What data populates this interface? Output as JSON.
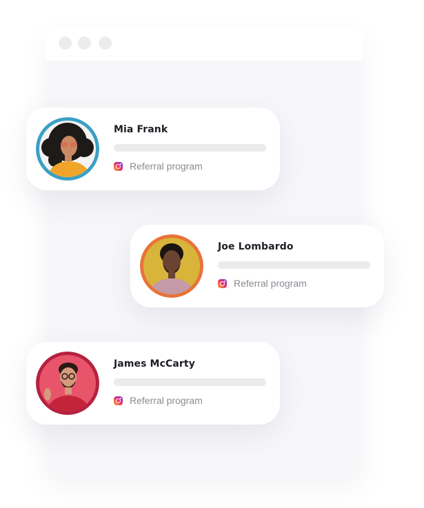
{
  "window": {
    "dots": [
      "window-dot",
      "window-dot",
      "window-dot"
    ]
  },
  "cards": [
    {
      "name": "Mia Frank",
      "source": "Referral program",
      "source_icon": "instagram-icon",
      "ring_color": "#3aa0c4"
    },
    {
      "name": "Joe Lombardo",
      "source": "Referral program",
      "source_icon": "instagram-icon",
      "ring_color": "#e8733a"
    },
    {
      "name": "James McCarty",
      "source": "Referral program",
      "source_icon": "instagram-icon",
      "ring_color": "#b5213f"
    }
  ]
}
